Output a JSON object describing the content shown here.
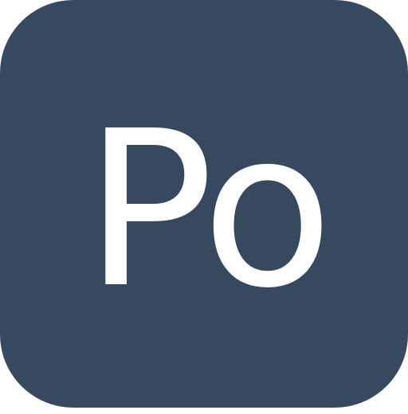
{
  "app_icon": {
    "label": "Po",
    "background_color": "#36495f",
    "text_color": "#ffffff"
  }
}
